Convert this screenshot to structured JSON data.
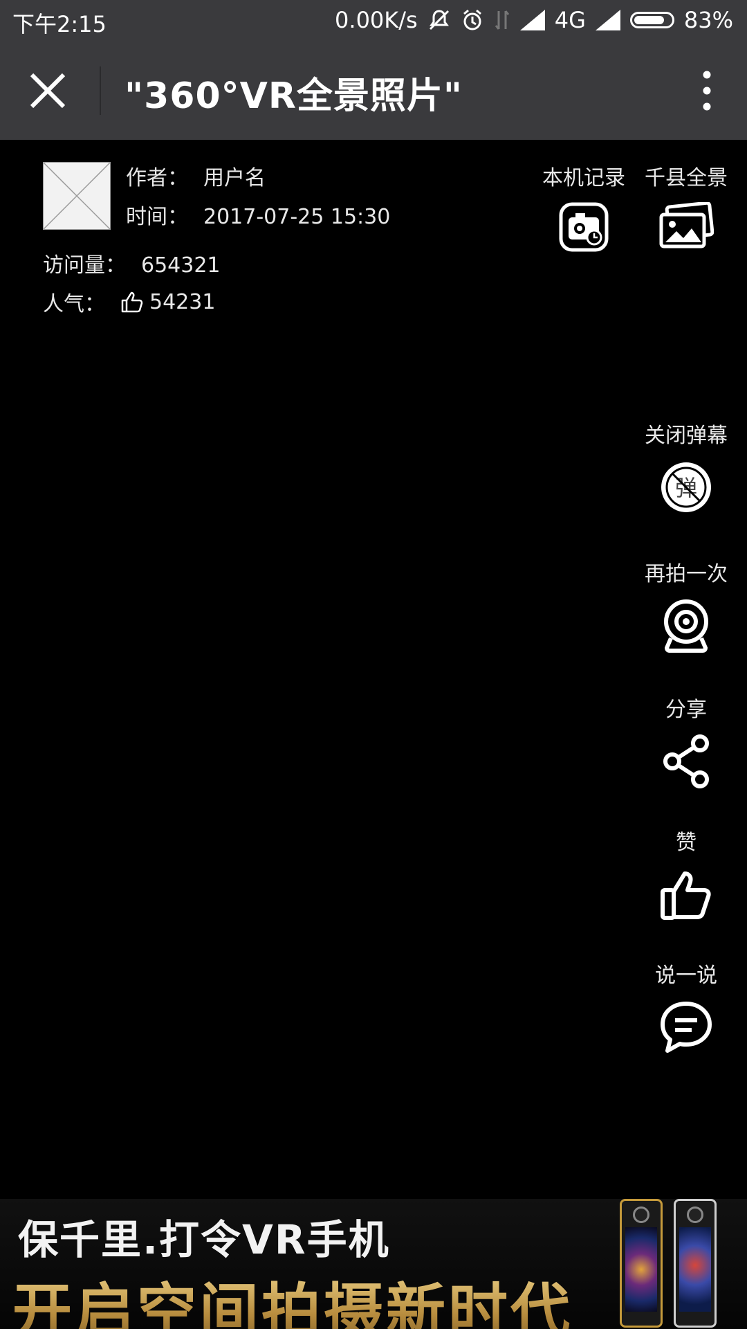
{
  "status_bar": {
    "time": "下午2:15",
    "speed": "0.00K/s",
    "network": "4G",
    "battery": "83%",
    "battery_level": 0.83
  },
  "app_bar": {
    "title": "\"360°VR全景照片\""
  },
  "info": {
    "author_label": "作者：",
    "author_value": "用户名",
    "time_label": "时间：",
    "time_value": "2017-07-25 15:30",
    "visits_label": "访问量：",
    "visits_value": "654321",
    "popularity_label": "人气：",
    "popularity_value": "54231"
  },
  "actions": {
    "local_record": "本机记录",
    "county_panorama": "千县全景",
    "close_danmaku": "关闭弹幕",
    "danmaku_glyph": "弹",
    "retake": "再拍一次",
    "share": "分享",
    "like": "赞",
    "comment": "说一说"
  },
  "banner": {
    "line1": "保千里.打令VR手机",
    "line2": "开启空间拍摄新时代"
  }
}
